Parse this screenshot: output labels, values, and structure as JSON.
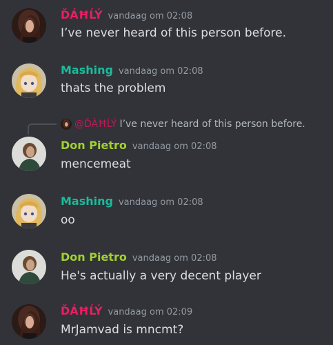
{
  "colors": {
    "background": "#313338",
    "dahly": "#e91e63",
    "mashing": "#1abc9c",
    "don_pietro": "#a3d12f",
    "timestamp": "#949ba4",
    "message_text": "#dbdee1"
  },
  "messages": [
    {
      "author": "ĎÁĦĹÝ",
      "timestamp": "vandaag om 02:08",
      "text": "I’ve never heard of this person before.",
      "avatar": "dahly-avatar"
    },
    {
      "author": "Mashing",
      "timestamp": "vandaag om 02:08",
      "text": "thats the problem",
      "avatar": "mashing-avatar"
    },
    {
      "reply": {
        "author": "@ĎÁĦĹÝ",
        "text": "I’ve never heard of this person before."
      },
      "author": "Don Pietro",
      "timestamp": "vandaag om 02:08",
      "text": "mencemeat",
      "avatar": "don-pietro-avatar"
    },
    {
      "author": "Mashing",
      "timestamp": "vandaag om 02:08",
      "text": "oo",
      "avatar": "mashing-avatar"
    },
    {
      "author": "Don Pietro",
      "timestamp": "vandaag om 02:08",
      "text": "He's actually a very decent player",
      "avatar": "don-pietro-avatar"
    },
    {
      "author": "ĎÁĦĹÝ",
      "timestamp": "vandaag om 02:09",
      "text": "MrJamvad is mncmt?",
      "avatar": "dahly-avatar"
    }
  ]
}
